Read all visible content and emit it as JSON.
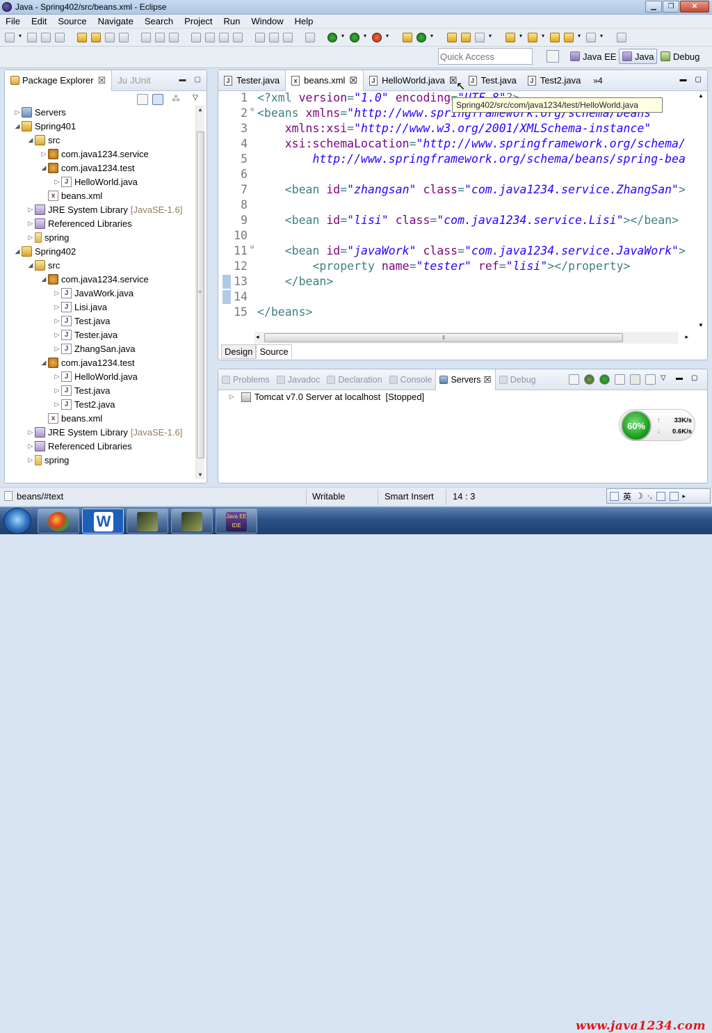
{
  "window": {
    "title": "Java - Spring402/src/beans.xml - Eclipse"
  },
  "menu": [
    "File",
    "Edit",
    "Source",
    "Navigate",
    "Search",
    "Project",
    "Run",
    "Window",
    "Help"
  ],
  "quick_access": {
    "placeholder": "Quick Access"
  },
  "perspectives": [
    {
      "label": "Java EE",
      "active": false
    },
    {
      "label": "Java",
      "active": true
    },
    {
      "label": "Debug",
      "active": false
    }
  ],
  "package_explorer": {
    "tabs": [
      {
        "label": "Package Explorer"
      },
      {
        "label": "JUnit",
        "prefix": "Ju"
      }
    ],
    "tree": [
      {
        "label": "Servers",
        "indent": 0,
        "arrow": "▷",
        "icon": "srv"
      },
      {
        "label": "Spring401",
        "indent": 0,
        "arrow": "◢",
        "icon": "proj"
      },
      {
        "label": "src",
        "indent": 1,
        "arrow": "◢",
        "icon": "srcf"
      },
      {
        "label": "com.java1234.service",
        "indent": 2,
        "arrow": "▷",
        "icon": "pkg"
      },
      {
        "label": "com.java1234.test",
        "indent": 2,
        "arrow": "◢",
        "icon": "pkg"
      },
      {
        "label": "HelloWorld.java",
        "indent": 3,
        "arrow": "▷",
        "icon": "java"
      },
      {
        "label": "beans.xml",
        "indent": 2,
        "arrow": "",
        "icon": "xml"
      },
      {
        "label": "JRE System Library",
        "extra": "[JavaSE-1.6]",
        "indent": 1,
        "arrow": "▷",
        "icon": "lib"
      },
      {
        "label": "Referenced Libraries",
        "indent": 1,
        "arrow": "▷",
        "icon": "lib"
      },
      {
        "label": "spring",
        "indent": 1,
        "arrow": "▷",
        "icon": "fold"
      },
      {
        "label": "Spring402",
        "indent": 0,
        "arrow": "◢",
        "icon": "proj"
      },
      {
        "label": "src",
        "indent": 1,
        "arrow": "◢",
        "icon": "srcf"
      },
      {
        "label": "com.java1234.service",
        "indent": 2,
        "arrow": "◢",
        "icon": "pkg"
      },
      {
        "label": "JavaWork.java",
        "indent": 3,
        "arrow": "▷",
        "icon": "java"
      },
      {
        "label": "Lisi.java",
        "indent": 3,
        "arrow": "▷",
        "icon": "java"
      },
      {
        "label": "Test.java",
        "indent": 3,
        "arrow": "▷",
        "icon": "java"
      },
      {
        "label": "Tester.java",
        "indent": 3,
        "arrow": "▷",
        "icon": "java"
      },
      {
        "label": "ZhangSan.java",
        "indent": 3,
        "arrow": "▷",
        "icon": "java"
      },
      {
        "label": "com.java1234.test",
        "indent": 2,
        "arrow": "◢",
        "icon": "pkg"
      },
      {
        "label": "HelloWorld.java",
        "indent": 3,
        "arrow": "▷",
        "icon": "java"
      },
      {
        "label": "Test.java",
        "indent": 3,
        "arrow": "▷",
        "icon": "java"
      },
      {
        "label": "Test2.java",
        "indent": 3,
        "arrow": "▷",
        "icon": "java"
      },
      {
        "label": "beans.xml",
        "indent": 2,
        "arrow": "",
        "icon": "xml"
      },
      {
        "label": "JRE System Library",
        "extra": "[JavaSE-1.6]",
        "indent": 1,
        "arrow": "▷",
        "icon": "lib"
      },
      {
        "label": "Referenced Libraries",
        "indent": 1,
        "arrow": "▷",
        "icon": "lib"
      },
      {
        "label": "spring",
        "indent": 1,
        "arrow": "▷",
        "icon": "fold"
      }
    ]
  },
  "editor": {
    "tabs": [
      {
        "label": "Tester.java",
        "icon": "J",
        "active": false
      },
      {
        "label": "beans.xml",
        "icon": "x",
        "active": true,
        "close": "☒"
      },
      {
        "label": "HelloWorld.java",
        "icon": "J",
        "active": false,
        "close": "☒"
      },
      {
        "label": "Test.java",
        "icon": "J",
        "active": false
      },
      {
        "label": "Test2.java",
        "icon": "J",
        "active": false
      }
    ],
    "more_tabs": "»4",
    "tooltip": "Spring402/src/com/java1234/test/HelloWorld.java",
    "lines": [
      {
        "n": "1",
        "fold": "",
        "segs": [
          [
            "t",
            "<?xml "
          ],
          [
            "a",
            "version"
          ],
          [
            "t",
            "="
          ],
          [
            "v",
            "\"1.0\""
          ],
          [
            "t",
            " "
          ],
          [
            "a",
            "encoding"
          ],
          [
            "t",
            "="
          ],
          [
            "v",
            "\"UTF-8\""
          ],
          [
            "t",
            "?>"
          ]
        ]
      },
      {
        "n": "2",
        "fold": "⊖",
        "segs": [
          [
            "t",
            "<beans "
          ],
          [
            "a",
            "xmlns"
          ],
          [
            "t",
            "="
          ],
          [
            "v",
            "\"http://www.springframework.org/schema/beans\""
          ]
        ]
      },
      {
        "n": "3",
        "fold": "",
        "segs": [
          [
            "t",
            "    "
          ],
          [
            "a",
            "xmlns:xsi"
          ],
          [
            "t",
            "="
          ],
          [
            "v",
            "\"http://www.w3.org/2001/XMLSchema-instance\""
          ]
        ]
      },
      {
        "n": "4",
        "fold": "",
        "segs": [
          [
            "t",
            "    "
          ],
          [
            "a",
            "xsi:schemaLocation"
          ],
          [
            "t",
            "="
          ],
          [
            "v",
            "\"http://www.springframework.org/schema/"
          ]
        ]
      },
      {
        "n": "5",
        "fold": "",
        "segs": [
          [
            "t",
            "        "
          ],
          [
            "v",
            "http://www.springframework.org/schema/beans/spring-bea"
          ]
        ]
      },
      {
        "n": "6",
        "fold": "",
        "segs": []
      },
      {
        "n": "7",
        "fold": "",
        "segs": [
          [
            "t",
            "    <bean "
          ],
          [
            "a",
            "id"
          ],
          [
            "t",
            "="
          ],
          [
            "v",
            "\"zhangsan\""
          ],
          [
            "t",
            " "
          ],
          [
            "a",
            "class"
          ],
          [
            "t",
            "="
          ],
          [
            "v",
            "\"com.java1234.service.ZhangSan\""
          ],
          [
            "t",
            ">"
          ]
        ]
      },
      {
        "n": "8",
        "fold": "",
        "segs": []
      },
      {
        "n": "9",
        "fold": "",
        "segs": [
          [
            "t",
            "    <bean "
          ],
          [
            "a",
            "id"
          ],
          [
            "t",
            "="
          ],
          [
            "v",
            "\"lisi\""
          ],
          [
            "t",
            " "
          ],
          [
            "a",
            "class"
          ],
          [
            "t",
            "="
          ],
          [
            "v",
            "\"com.java1234.service.Lisi\""
          ],
          [
            "t",
            "></bean>"
          ]
        ]
      },
      {
        "n": "10",
        "fold": "",
        "segs": []
      },
      {
        "n": "11",
        "fold": "⊖",
        "segs": [
          [
            "t",
            "    <bean "
          ],
          [
            "a",
            "id"
          ],
          [
            "t",
            "="
          ],
          [
            "v",
            "\"javaWork\""
          ],
          [
            "t",
            " "
          ],
          [
            "a",
            "class"
          ],
          [
            "t",
            "="
          ],
          [
            "v",
            "\"com.java1234.service.JavaWork\""
          ],
          [
            "t",
            ">"
          ]
        ]
      },
      {
        "n": "12",
        "fold": "",
        "segs": [
          [
            "t",
            "        <property "
          ],
          [
            "a",
            "name"
          ],
          [
            "t",
            "="
          ],
          [
            "v",
            "\"tester\""
          ],
          [
            "t",
            " "
          ],
          [
            "a",
            "ref"
          ],
          [
            "t",
            "="
          ],
          [
            "v",
            "\"lisi\""
          ],
          [
            "t",
            "></property>"
          ]
        ]
      },
      {
        "n": "13",
        "fold": "",
        "segs": [
          [
            "t",
            "    </bean>"
          ]
        ]
      },
      {
        "n": "14",
        "fold": "",
        "segs": []
      },
      {
        "n": "15",
        "fold": "",
        "segs": [
          [
            "t",
            "</beans>"
          ]
        ]
      }
    ],
    "bottom_tabs": [
      "Design",
      "Source"
    ]
  },
  "bottom_panel": {
    "tabs": [
      {
        "label": "Problems",
        "active": false
      },
      {
        "label": "Javadoc",
        "active": false
      },
      {
        "label": "Declaration",
        "active": false
      },
      {
        "label": "Console",
        "active": false
      },
      {
        "label": "Servers",
        "active": true
      },
      {
        "label": "Debug",
        "active": false
      }
    ],
    "server": "Tomcat v7.0 Server at localhost  [Stopped]"
  },
  "netmon": {
    "percent": "60%",
    "up": "33K/s",
    "down": "0.6K/s"
  },
  "status": {
    "path": "beans/#text",
    "writable": "Writable",
    "insert": "Smart Insert",
    "pos": "14 : 3"
  },
  "ime": {
    "lang": "英"
  },
  "taskbar": {
    "watermark": "www.java1234.com"
  }
}
